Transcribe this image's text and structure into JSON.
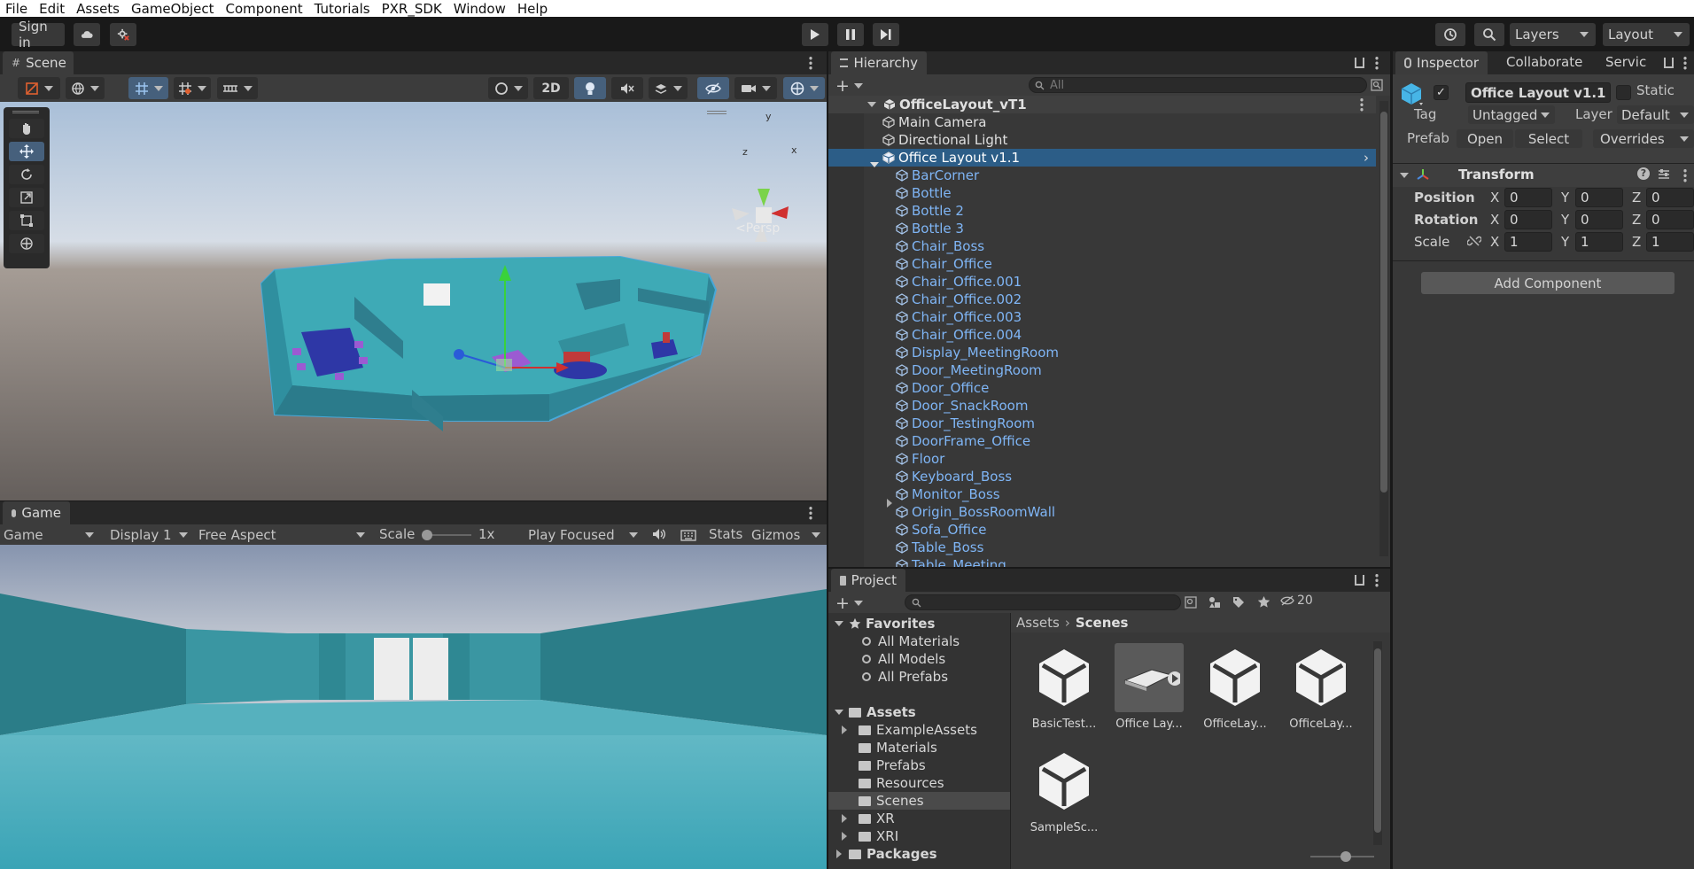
{
  "menu": [
    "File",
    "Edit",
    "Assets",
    "GameObject",
    "Component",
    "Tutorials",
    "PXR_SDK",
    "Window",
    "Help"
  ],
  "toolbar": {
    "sign_in": "Sign in",
    "layers": "Layers",
    "layout": "Layout"
  },
  "scene": {
    "tab": "Scene",
    "btn_2d": "2D",
    "persp": "<Persp",
    "gizmo_axes": {
      "y": "y",
      "z": "z",
      "x": "x"
    }
  },
  "game": {
    "tab": "Game",
    "mode": "Game",
    "display": "Display 1",
    "aspect": "Free Aspect",
    "scale_label": "Scale",
    "scale_value": "1x",
    "play_mode": "Play Focused",
    "stats": "Stats",
    "gizmos": "Gizmos"
  },
  "hierarchy": {
    "tab": "Hierarchy",
    "search_placeholder": "All",
    "root": "OfficeLayout_vT1",
    "items": [
      {
        "label": "Main Camera",
        "depth": 1,
        "prefab": false,
        "selected": false,
        "foldout": false
      },
      {
        "label": "Directional Light",
        "depth": 1,
        "prefab": false,
        "selected": false,
        "foldout": false
      },
      {
        "label": "Office Layout v1.1",
        "depth": 1,
        "prefab": false,
        "selected": true,
        "foldout": true
      },
      {
        "label": "BarCorner",
        "depth": 2,
        "prefab": true,
        "selected": false,
        "foldout": false
      },
      {
        "label": "Bottle",
        "depth": 2,
        "prefab": true,
        "selected": false,
        "foldout": false
      },
      {
        "label": "Bottle 2",
        "depth": 2,
        "prefab": true,
        "selected": false,
        "foldout": false
      },
      {
        "label": "Bottle 3",
        "depth": 2,
        "prefab": true,
        "selected": false,
        "foldout": false
      },
      {
        "label": "Chair_Boss",
        "depth": 2,
        "prefab": true,
        "selected": false,
        "foldout": false
      },
      {
        "label": "Chair_Office",
        "depth": 2,
        "prefab": true,
        "selected": false,
        "foldout": false
      },
      {
        "label": "Chair_Office.001",
        "depth": 2,
        "prefab": true,
        "selected": false,
        "foldout": false
      },
      {
        "label": "Chair_Office.002",
        "depth": 2,
        "prefab": true,
        "selected": false,
        "foldout": false
      },
      {
        "label": "Chair_Office.003",
        "depth": 2,
        "prefab": true,
        "selected": false,
        "foldout": false
      },
      {
        "label": "Chair_Office.004",
        "depth": 2,
        "prefab": true,
        "selected": false,
        "foldout": false
      },
      {
        "label": "Display_MeetingRoom",
        "depth": 2,
        "prefab": true,
        "selected": false,
        "foldout": false
      },
      {
        "label": "Door_MeetingRoom",
        "depth": 2,
        "prefab": true,
        "selected": false,
        "foldout": false
      },
      {
        "label": "Door_Office",
        "depth": 2,
        "prefab": true,
        "selected": false,
        "foldout": false
      },
      {
        "label": "Door_SnackRoom",
        "depth": 2,
        "prefab": true,
        "selected": false,
        "foldout": false
      },
      {
        "label": "Door_TestingRoom",
        "depth": 2,
        "prefab": true,
        "selected": false,
        "foldout": false
      },
      {
        "label": "DoorFrame_Office",
        "depth": 2,
        "prefab": true,
        "selected": false,
        "foldout": false
      },
      {
        "label": "Floor",
        "depth": 2,
        "prefab": true,
        "selected": false,
        "foldout": false
      },
      {
        "label": "Keyboard_Boss",
        "depth": 2,
        "prefab": true,
        "selected": false,
        "foldout": false
      },
      {
        "label": "Monitor_Boss",
        "depth": 2,
        "prefab": true,
        "selected": false,
        "foldout": true
      },
      {
        "label": "Origin_BossRoomWall",
        "depth": 2,
        "prefab": true,
        "selected": false,
        "foldout": false
      },
      {
        "label": "Sofa_Office",
        "depth": 2,
        "prefab": true,
        "selected": false,
        "foldout": false
      },
      {
        "label": "Table_Boss",
        "depth": 2,
        "prefab": true,
        "selected": false,
        "foldout": false
      },
      {
        "label": "Table_Meeting",
        "depth": 2,
        "prefab": true,
        "selected": false,
        "foldout": false
      }
    ]
  },
  "inspector": {
    "tabs": [
      "Inspector",
      "Collaborate",
      "Servic"
    ],
    "object_name": "Office Layout v1.1",
    "static_label": "Static",
    "tag_label": "Tag",
    "tag_value": "Untagged",
    "layer_label": "Layer",
    "layer_value": "Default",
    "prefab_label": "Prefab",
    "prefab_open": "Open",
    "prefab_select": "Select",
    "prefab_overrides": "Overrides",
    "transform_title": "Transform",
    "position_label": "Position",
    "rotation_label": "Rotation",
    "scale_label": "Scale",
    "axis_x": "X",
    "axis_y": "Y",
    "axis_z": "Z",
    "position": [
      "0",
      "0",
      "0"
    ],
    "rotation": [
      "0",
      "0",
      "0"
    ],
    "scale": [
      "1",
      "1",
      "1"
    ],
    "add_component": "Add Component"
  },
  "project": {
    "tab": "Project",
    "hidden_count": "20",
    "favorites_label": "Favorites",
    "favorites": [
      "All Materials",
      "All Models",
      "All Prefabs"
    ],
    "assets_label": "Assets",
    "folders": [
      {
        "label": "ExampleAssets",
        "foldout": true,
        "selected": false
      },
      {
        "label": "Materials",
        "foldout": false,
        "selected": false
      },
      {
        "label": "Prefabs",
        "foldout": false,
        "selected": false
      },
      {
        "label": "Resources",
        "foldout": false,
        "selected": false
      },
      {
        "label": "Scenes",
        "foldout": false,
        "selected": true
      },
      {
        "label": "XR",
        "foldout": true,
        "selected": false
      },
      {
        "label": "XRI",
        "foldout": true,
        "selected": false
      }
    ],
    "packages_label": "Packages",
    "breadcrumb": [
      "Assets",
      "Scenes"
    ],
    "assets": [
      {
        "label": "BasicTest...",
        "kind": "unity"
      },
      {
        "label": "Office Lay...",
        "kind": "model"
      },
      {
        "label": "OfficeLay...",
        "kind": "unity"
      },
      {
        "label": "OfficeLay...",
        "kind": "unity"
      },
      {
        "label": "SampleSc...",
        "kind": "unity"
      }
    ]
  }
}
